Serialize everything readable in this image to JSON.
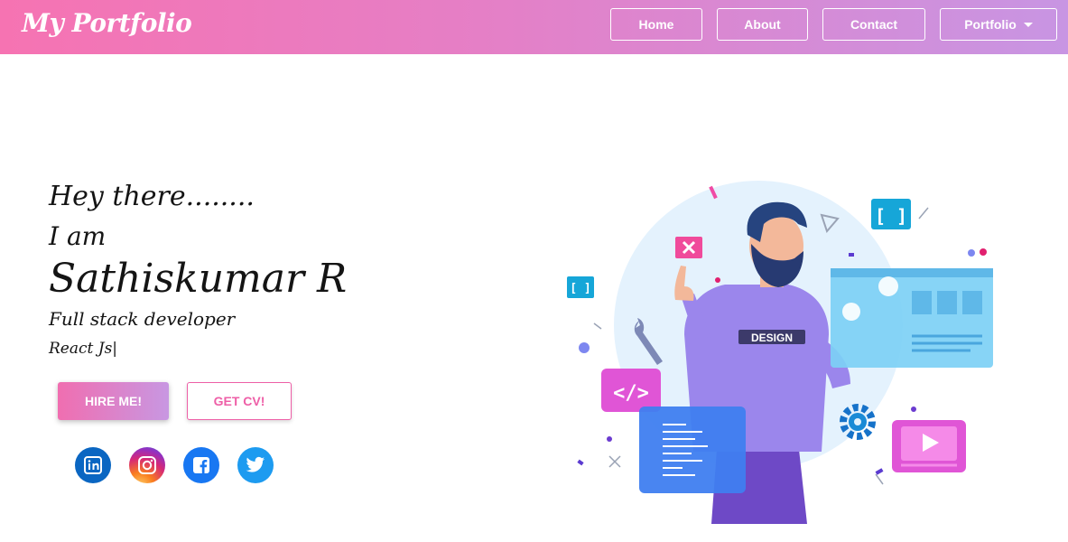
{
  "navbar": {
    "brand": "My Portfolio",
    "links": [
      "Home",
      "About",
      "Contact"
    ],
    "dropdown_label": "Portfolio"
  },
  "hero": {
    "greeting": "Hey there........",
    "intro": "I am",
    "name": "Sathiskumar R",
    "role": "Full stack developer",
    "typed_text": "React Js|",
    "hire_button": "HIRE ME!",
    "cv_button": "GET CV!",
    "illustration_badge": "DESIGN"
  },
  "social": [
    "linkedin-icon",
    "instagram-icon",
    "facebook-icon",
    "twitter-icon"
  ],
  "colors": {
    "nav_gradient_start": "#f673b2",
    "nav_gradient_end": "#c895e3",
    "accent_pink": "#ee5fa7",
    "linkedin": "#0a66c2",
    "facebook": "#1877f2",
    "twitter": "#1d9bf0"
  }
}
